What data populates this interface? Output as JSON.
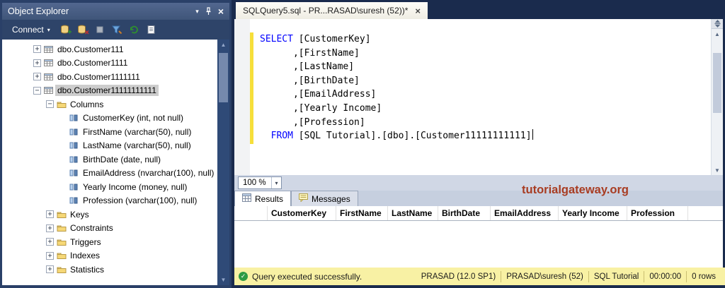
{
  "icons": {
    "chevron_down": "▾",
    "close": "×",
    "up_arrow": "▲",
    "down_arrow": "▼",
    "check": "✓"
  },
  "colors": {
    "keyword_blue": "#0000ff",
    "status_bar_yellow": "#f8f1a4",
    "watermark_red": "#a83c22",
    "success_green": "#2e9b44",
    "change_bar_yellow": "#f6df3a"
  },
  "object_explorer": {
    "title": "Object Explorer",
    "toolbar": {
      "connect_label": "Connect",
      "icons": [
        "connect",
        "disconnect",
        "stop",
        "filter",
        "refresh",
        "script"
      ]
    },
    "tree": [
      {
        "label": "dbo.Customer111",
        "type": "table",
        "expand": "plus",
        "indent": 1
      },
      {
        "label": "dbo.Customer1111",
        "type": "table",
        "expand": "plus",
        "indent": 1
      },
      {
        "label": "dbo.Customer1111111",
        "type": "table",
        "expand": "plus",
        "indent": 1
      },
      {
        "label": "dbo.Customer11111111111",
        "type": "table",
        "expand": "minus",
        "indent": 1,
        "selected": true
      },
      {
        "label": "Columns",
        "type": "folder",
        "expand": "minus",
        "indent": 2
      },
      {
        "label": "CustomerKey (int, not null)",
        "type": "column",
        "indent": 3
      },
      {
        "label": "FirstName (varchar(50), null)",
        "type": "column",
        "indent": 3
      },
      {
        "label": "LastName (varchar(50), null)",
        "type": "column",
        "indent": 3
      },
      {
        "label": "BirthDate (date, null)",
        "type": "column",
        "indent": 3
      },
      {
        "label": "EmailAddress (nvarchar(100), null)",
        "type": "column",
        "indent": 3
      },
      {
        "label": "Yearly Income (money, null)",
        "type": "column",
        "indent": 3
      },
      {
        "label": "Profession (varchar(100), null)",
        "type": "column",
        "indent": 3
      },
      {
        "label": "Keys",
        "type": "folder",
        "expand": "plus",
        "indent": 2
      },
      {
        "label": "Constraints",
        "type": "folder",
        "expand": "plus",
        "indent": 2
      },
      {
        "label": "Triggers",
        "type": "folder",
        "expand": "plus",
        "indent": 2
      },
      {
        "label": "Indexes",
        "type": "folder",
        "expand": "plus",
        "indent": 2
      },
      {
        "label": "Statistics",
        "type": "folder",
        "expand": "plus",
        "indent": 2
      }
    ]
  },
  "editor": {
    "tab_title": "SQLQuery5.sql - PR...RASAD\\suresh (52))*",
    "zoom": "100 %",
    "lines": [
      {
        "pre": "",
        "kw": "SELECT",
        "post": " [CustomerKey]"
      },
      {
        "pre": "      ",
        "kw": "",
        "post": ",[FirstName]"
      },
      {
        "pre": "      ",
        "kw": "",
        "post": ",[LastName]"
      },
      {
        "pre": "      ",
        "kw": "",
        "post": ",[BirthDate]"
      },
      {
        "pre": "      ",
        "kw": "",
        "post": ",[EmailAddress]"
      },
      {
        "pre": "      ",
        "kw": "",
        "post": ",[Yearly Income]"
      },
      {
        "pre": "      ",
        "kw": "",
        "post": ",[Profession]"
      },
      {
        "pre": "  ",
        "kw": "FROM",
        "post": " [SQL Tutorial].[dbo].[Customer11111111111]"
      }
    ]
  },
  "results": {
    "tab_results": "Results",
    "tab_messages": "Messages",
    "columns": [
      "CustomerKey",
      "FirstName",
      "LastName",
      "BirthDate",
      "EmailAddress",
      "Yearly Income",
      "Profession"
    ]
  },
  "watermark": "tutorialgateway.org",
  "status_bar": {
    "message": "Query executed successfully.",
    "server": "PRASAD (12.0 SP1)",
    "user": "PRASAD\\suresh (52)",
    "database": "SQL Tutorial",
    "time": "00:00:00",
    "rows": "0 rows"
  }
}
